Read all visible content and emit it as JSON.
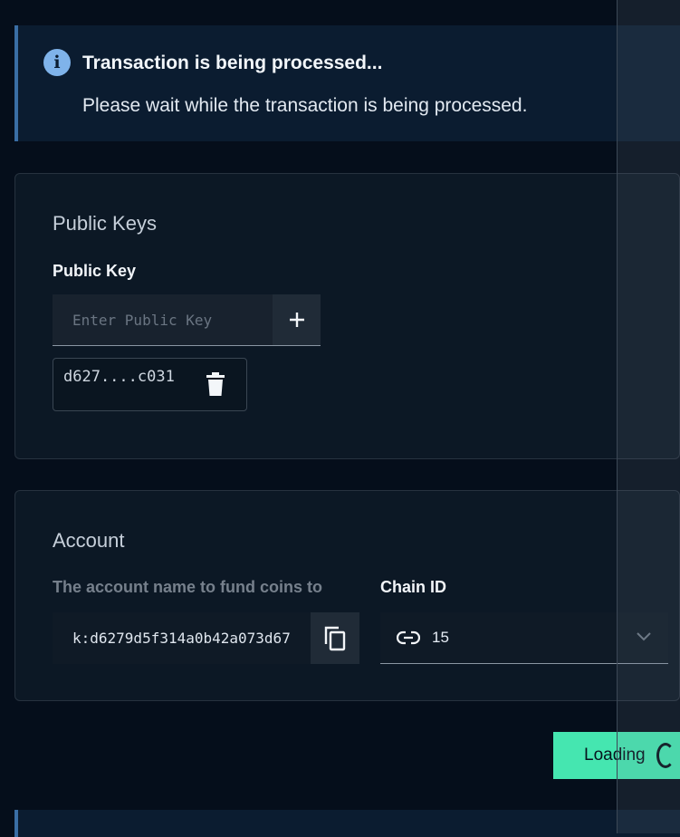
{
  "notification": {
    "icon": "info-icon",
    "title": "Transaction is being processed...",
    "message": "Please wait while the transaction is being processed."
  },
  "public_keys": {
    "heading": "Public Keys",
    "field_label": "Public Key",
    "input_placeholder": "Enter Public Key",
    "add_icon": "plus-icon",
    "keys": [
      "d627....c031"
    ],
    "delete_icon": "trash-icon"
  },
  "account": {
    "heading": "Account",
    "account_label": "The account name to fund coins to",
    "account_value": "k:d6279d5f314a0b42a073d67",
    "copy_icon": "copy-icon",
    "chain_label": "Chain ID",
    "chain_icon": "link-icon",
    "chain_value": "15",
    "dropdown_icon": "chevron-down-icon"
  },
  "submit": {
    "label": "Loading"
  },
  "colors": {
    "background": "#050e1b",
    "card": "#0c1825",
    "banner": "#0b1c30",
    "accent": "#45e6b0",
    "info": "#7fb3ea"
  }
}
